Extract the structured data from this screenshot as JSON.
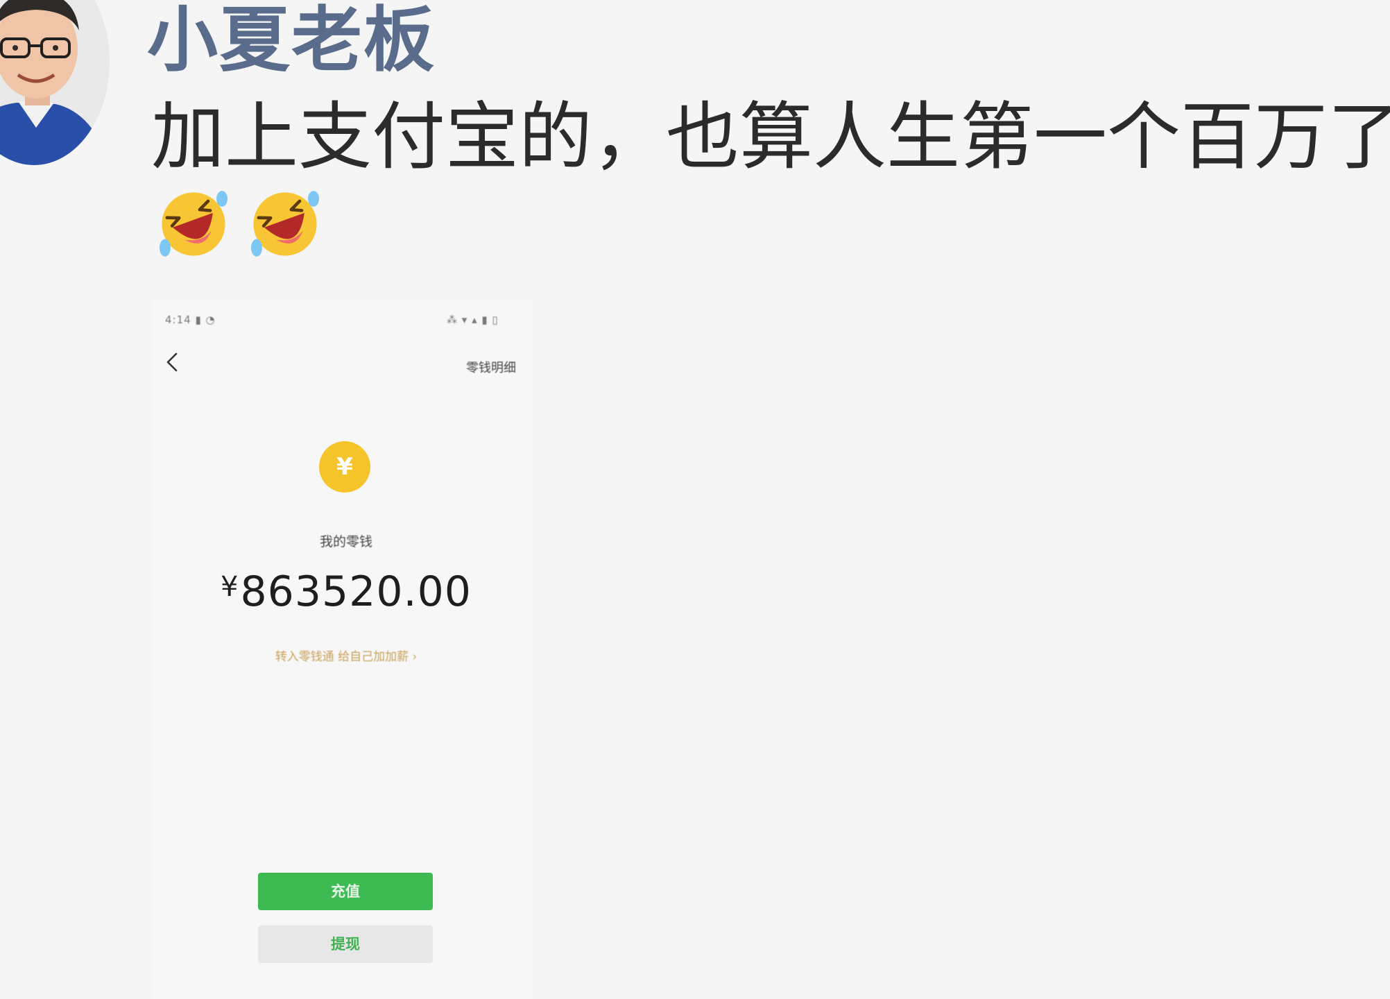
{
  "post": {
    "author": "小夏老板",
    "text": "加上支付宝的，也算人生第一个百万了",
    "emojis": [
      "rolling-on-floor-laughing-icon",
      "rolling-on-floor-laughing-icon"
    ]
  },
  "wallet": {
    "status_left": "4:14 ▮ ◔",
    "status_right": "⁂ ▾ ▴ ▮ ▯",
    "details_link": "零钱明细",
    "coin_symbol": "¥",
    "change_label": "我的零钱",
    "currency": "¥",
    "balance": "863520.00",
    "promo_link": "转入零钱通 给自己加加薪 ›",
    "recharge_label": "充值",
    "withdraw_label": "提现"
  },
  "colors": {
    "author": "#5a6c8c",
    "primary_green": "#3dbb52",
    "coin_yellow": "#f5c42b",
    "promo_gold": "#c9a25a"
  }
}
